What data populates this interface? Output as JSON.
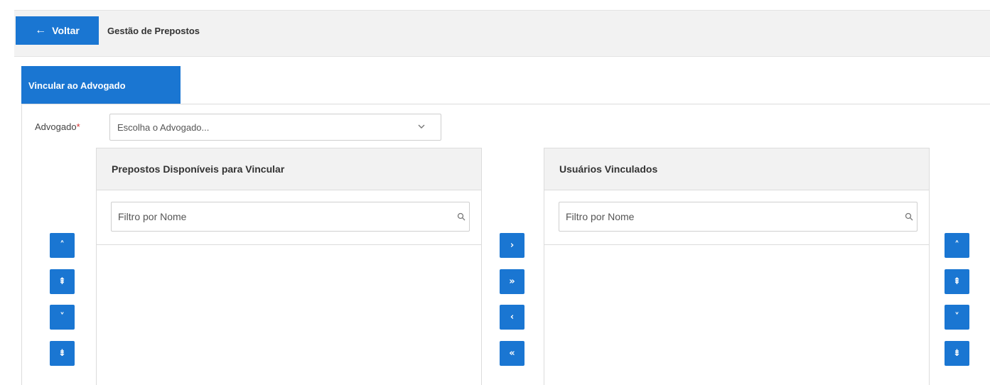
{
  "header": {
    "back_label": "Voltar",
    "back_arrow": "←",
    "title": "Gestão de Prepostos"
  },
  "tabs": [
    {
      "label": "Vincular ao Advogado",
      "active": true
    }
  ],
  "form": {
    "advogado_label": "Advogado",
    "required_mark": "*",
    "advogado_value": "Escolha o Advogado..."
  },
  "panels": {
    "available": {
      "title": "Prepostos Disponíveis para Vincular",
      "filter_placeholder": "Filtro por Nome"
    },
    "linked": {
      "title": "Usuários Vinculados",
      "filter_placeholder": "Filtro por Nome"
    }
  },
  "buttons": {
    "left_order": [
      {
        "icon": "chevron-up-icon",
        "glyph": "˄"
      },
      {
        "icon": "double-chevron-up-icon",
        "glyph": "⇞"
      },
      {
        "icon": "chevron-down-icon",
        "glyph": "˅"
      },
      {
        "icon": "double-chevron-down-icon",
        "glyph": "⇟"
      }
    ],
    "transfer": [
      {
        "icon": "chevron-right-icon",
        "glyph": "›"
      },
      {
        "icon": "double-chevron-right-icon",
        "glyph": "»"
      },
      {
        "icon": "chevron-left-icon",
        "glyph": "‹"
      },
      {
        "icon": "double-chevron-left-icon",
        "glyph": "«"
      }
    ],
    "right_order": [
      {
        "icon": "chevron-up-icon",
        "glyph": "˄"
      },
      {
        "icon": "double-chevron-up-icon",
        "glyph": "⇞"
      },
      {
        "icon": "chevron-down-icon",
        "glyph": "˅"
      },
      {
        "icon": "double-chevron-down-icon",
        "glyph": "⇟"
      }
    ]
  },
  "colors": {
    "primary": "#1a76d2",
    "header_bg": "#f2f2f2",
    "required": "#d32f2f"
  }
}
